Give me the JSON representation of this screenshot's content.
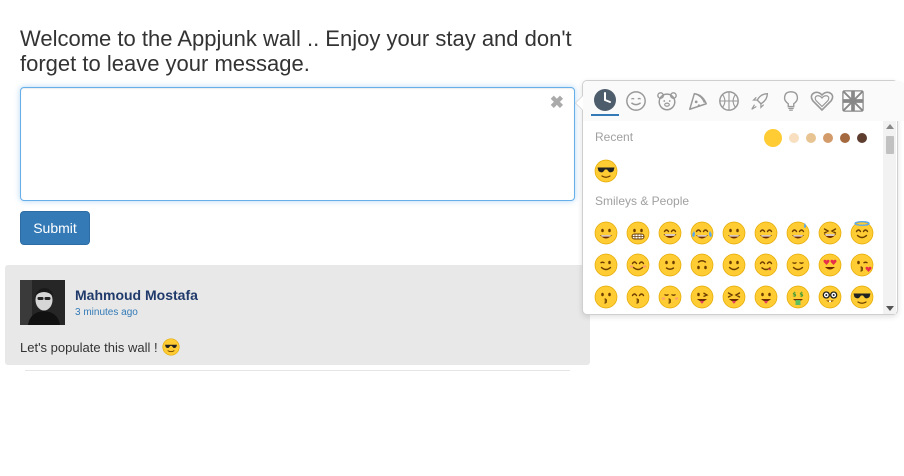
{
  "heading": "Welcome to the Appjunk wall .. Enjoy your stay and don't forget to leave your message.",
  "composer": {
    "value": "",
    "clear_glyph": "✖"
  },
  "submit_label": "Submit",
  "post": {
    "author": "Mahmoud Mostafa",
    "time": "3 minutes ago",
    "text": "Let's populate this wall !",
    "emoji": "smiling-face-with-sunglasses"
  },
  "picker": {
    "tabs": [
      {
        "name": "recent",
        "icon": "clock-icon",
        "active": true
      },
      {
        "name": "smileys-people",
        "icon": "smiley-icon"
      },
      {
        "name": "animals-nature",
        "icon": "bear-icon"
      },
      {
        "name": "food-drink",
        "icon": "pizza-icon"
      },
      {
        "name": "activity",
        "icon": "basketball-icon"
      },
      {
        "name": "travel-places",
        "icon": "rocket-icon"
      },
      {
        "name": "objects",
        "icon": "lightbulb-icon"
      },
      {
        "name": "symbols",
        "icon": "heart-icon"
      },
      {
        "name": "flags",
        "icon": "uk-flag-icon"
      }
    ],
    "recent_label": "Recent",
    "smileys_label": "Smileys & People",
    "skin_tones": [
      "#ffcc33",
      "#f7dfc0",
      "#e7c492",
      "#d39a6a",
      "#a4693f",
      "#5c3d2e"
    ],
    "recent": [
      "smiling-face-with-sunglasses"
    ],
    "smileys": [
      "grinning-face",
      "grimacing-face",
      "grinning-squinting-face",
      "face-with-tears-of-joy",
      "smiling-face-with-open-mouth",
      "smiling-face-with-smiling-eyes-open-mouth",
      "grinning-face-with-sweat",
      "laughing-face",
      "smiling-face-with-halo",
      "winking-face",
      "smiling-face-with-smiling-eyes",
      "slightly-smiling-face",
      "upside-down-face",
      "smiling-face",
      "face-savoring-food",
      "relieved-face",
      "smiling-face-with-heart-eyes",
      "face-blowing-a-kiss",
      "kissing-face",
      "kissing-face-with-smiling-eyes",
      "kissing-face-with-closed-eyes",
      "face-with-tongue-winking",
      "face-with-tongue-squinting",
      "face-with-tongue",
      "money-mouth-face",
      "nerd-face",
      "smiling-face-with-sunglasses"
    ]
  }
}
